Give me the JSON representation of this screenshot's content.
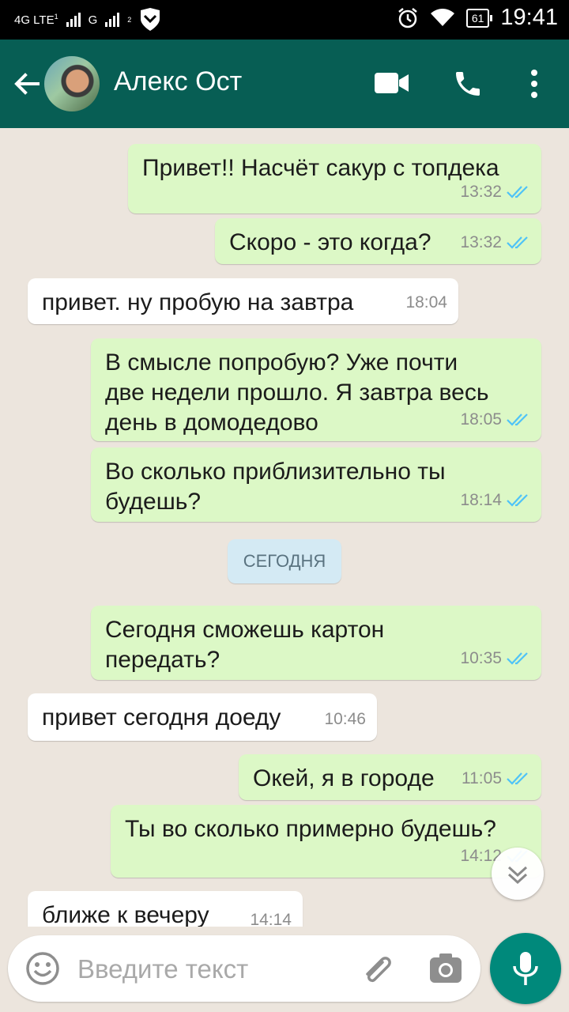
{
  "status_bar": {
    "network_left": "4G LTE",
    "network_left_sup": "1",
    "network_right": "G",
    "network_right_sup": "2",
    "battery": "61",
    "time": "19:41"
  },
  "header": {
    "contact_name": "Алекс Ост"
  },
  "messages": [
    {
      "dir": "out",
      "text": "Привет!! Насчёт сакур с топдека",
      "time": "13:32"
    },
    {
      "dir": "out",
      "text": "Скоро - это когда?",
      "time": "13:32"
    },
    {
      "dir": "in",
      "text": "привет. ну пробую на завтра",
      "time": "18:04"
    },
    {
      "dir": "out",
      "text": "В смысле попробую? Уже почти две недели прошло. Я завтра весь день в домодедово",
      "time": "18:05"
    },
    {
      "dir": "out",
      "text": "Во сколько приблизительно ты будешь?",
      "time": "18:14"
    },
    {
      "dir": "out",
      "text": "Сегодня сможешь картон передать?",
      "time": "10:35"
    },
    {
      "dir": "in",
      "text": "привет сегодня доеду",
      "time": "10:46"
    },
    {
      "dir": "out",
      "text": "Окей, я в городе",
      "time": "11:05"
    },
    {
      "dir": "out",
      "text": "Ты во сколько примерно будешь?",
      "time": "14:12"
    },
    {
      "dir": "in",
      "text": "ближе к вечеру",
      "time": "14:14"
    }
  ],
  "date_divider": "СЕГОДНЯ",
  "composer": {
    "placeholder": "Введите текст"
  },
  "colors": {
    "header": "#075e54",
    "outgoing_bubble": "#dcf8c6",
    "incoming_bubble": "#ffffff",
    "read_ticks": "#4fc3f7",
    "mic_button": "#00897b"
  },
  "icons": [
    "back-arrow-icon",
    "video-call-icon",
    "phone-icon",
    "more-vert-icon",
    "double-check-icon",
    "chevron-down-icon",
    "emoji-icon",
    "paperclip-icon",
    "camera-icon",
    "mic-icon"
  ]
}
